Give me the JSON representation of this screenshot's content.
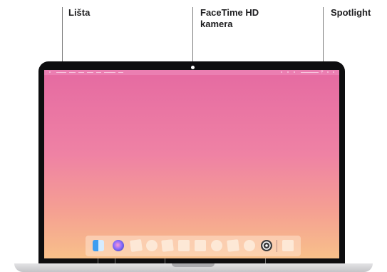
{
  "callouts": {
    "menu_bar": "Lišta",
    "camera": "FaceTime HD\nkamera",
    "spotlight": "Spotlight"
  },
  "icons": {
    "finder": "finder-icon",
    "siri": "siri-icon",
    "system_preferences": "system-preferences-icon",
    "spotlight": "magnifier-icon",
    "app_placeholders": [
      "app-placeholder-icon"
    ]
  },
  "colors": {
    "wallpaper_top": "#e56aa2",
    "wallpaper_bottom": "#f8c08a",
    "bezel": "#0d0d0f",
    "leader_lines": "#7a7a7a"
  }
}
